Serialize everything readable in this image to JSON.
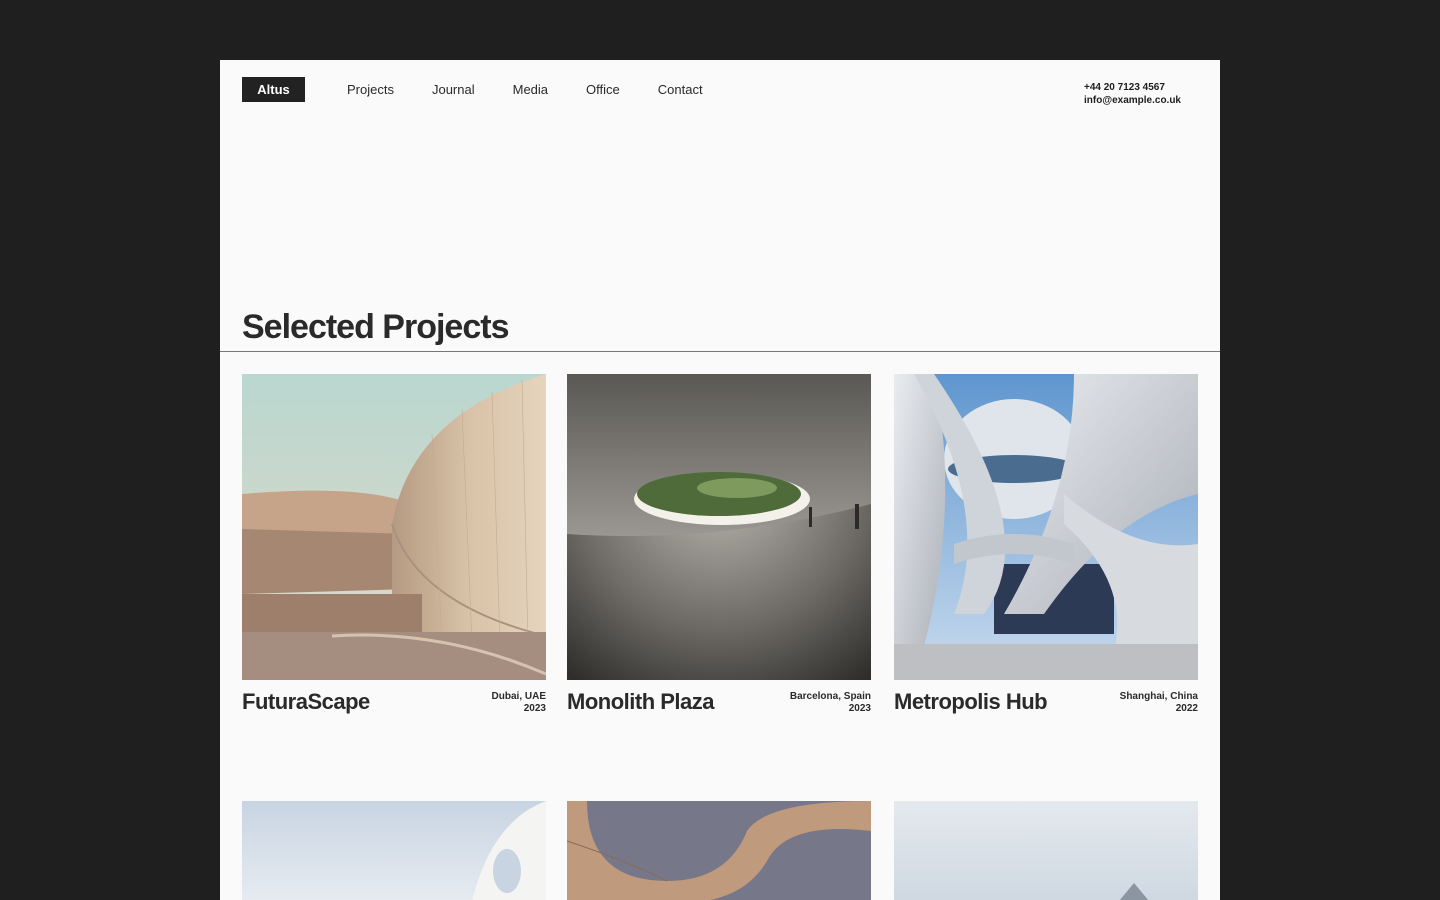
{
  "header": {
    "logo": "Altus",
    "nav": [
      "Projects",
      "Journal",
      "Media",
      "Office",
      "Contact"
    ],
    "phone": "+44 20 7123 4567",
    "email": "info@example.co.uk"
  },
  "section": {
    "title": "Selected Projects"
  },
  "projects": [
    {
      "title": "FuturaScape",
      "location": "Dubai, UAE",
      "year": "2023"
    },
    {
      "title": "Monolith Plaza",
      "location": "Barcelona, Spain",
      "year": "2023"
    },
    {
      "title": "Metropolis Hub",
      "location": "Shanghai, China",
      "year": "2022"
    }
  ],
  "colors": {
    "frame": "#1f1f1f",
    "page": "#fafafa",
    "text": "#2a2a2a",
    "logo_bg": "#222222"
  }
}
